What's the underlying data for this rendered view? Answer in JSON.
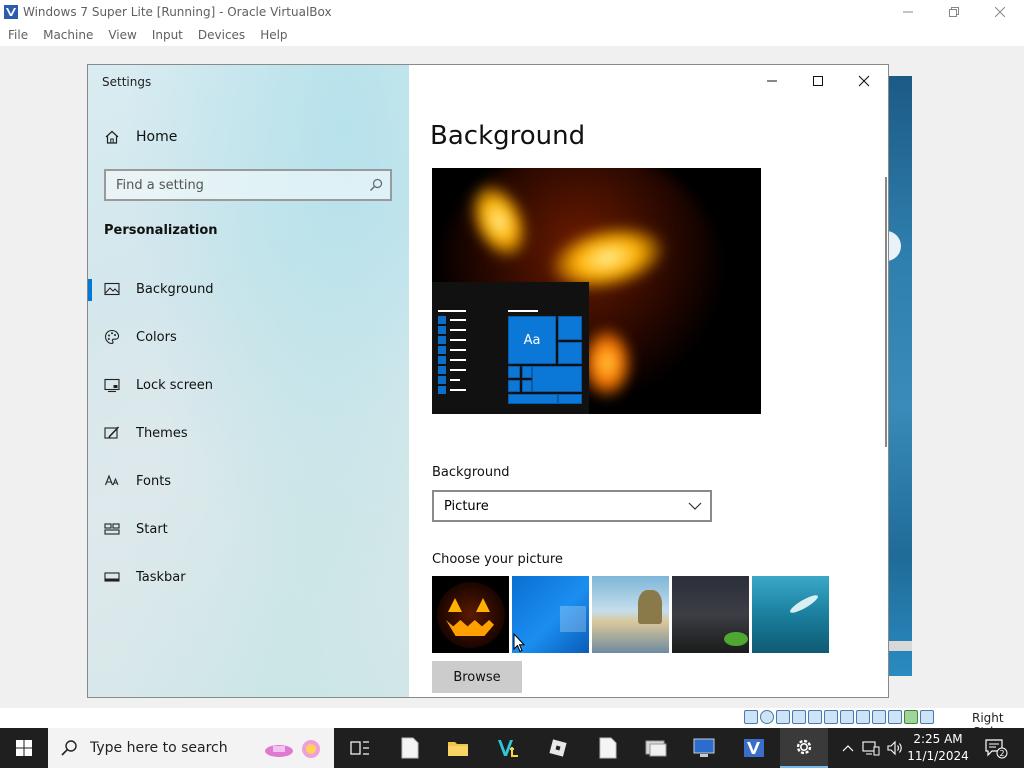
{
  "host": {
    "title": "Windows 7 Super Lite [Running] - Oracle VirtualBox",
    "menu": [
      "File",
      "Machine",
      "View",
      "Input",
      "Devices",
      "Help"
    ],
    "host_key": "Right Ctrl"
  },
  "settings": {
    "window_title": "Settings",
    "home_label": "Home",
    "search_placeholder": "Find a setting",
    "section": "Personalization",
    "nav": [
      {
        "label": "Background",
        "icon": "picture-icon",
        "active": true
      },
      {
        "label": "Colors",
        "icon": "palette-icon"
      },
      {
        "label": "Lock screen",
        "icon": "lock-screen-icon"
      },
      {
        "label": "Themes",
        "icon": "themes-brush-icon"
      },
      {
        "label": "Fonts",
        "icon": "fonts-icon"
      },
      {
        "label": "Start",
        "icon": "start-layout-icon"
      },
      {
        "label": "Taskbar",
        "icon": "taskbar-icon"
      }
    ],
    "page_title": "Background",
    "preview_tile_text": "Aa",
    "background_label": "Background",
    "background_value": "Picture",
    "choose_label": "Choose your picture",
    "browse_label": "Browse"
  },
  "taskbar": {
    "search_text": "Type here to search",
    "time": "2:25 AM",
    "date": "11/1/2024",
    "notification_count": "2"
  },
  "colors": {
    "accent": "#0078d7",
    "taskbar": "#1f1f1f"
  }
}
